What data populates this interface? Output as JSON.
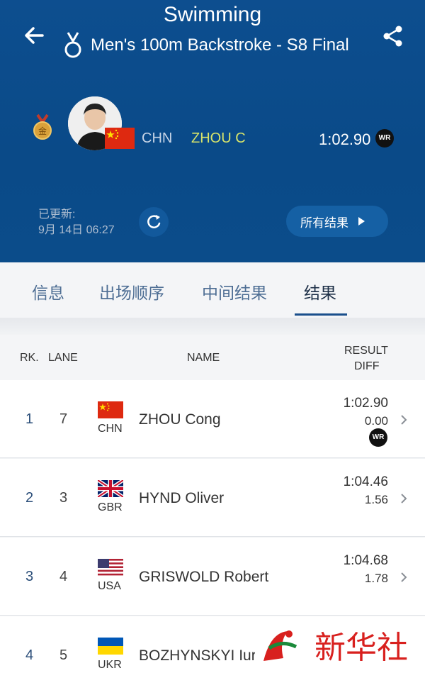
{
  "header": {
    "sport": "Swimming",
    "event": "Men's 100m Backstroke - S8 Final"
  },
  "winner": {
    "noc": "CHN",
    "name": "ZHOU C",
    "time": "1:02.90",
    "record": "WR",
    "medal_text": "金"
  },
  "update": {
    "label": "已更新:",
    "time": "9月 14日 06:27"
  },
  "all_results_label": "所有结果",
  "tabs": [
    {
      "label": "信息"
    },
    {
      "label": "出场顺序"
    },
    {
      "label": "中间结果"
    },
    {
      "label": "结果",
      "active": true
    }
  ],
  "table": {
    "headers": {
      "rank": "RK.",
      "lane": "LANE",
      "name": "NAME",
      "result": "RESULT",
      "diff": "DIFF"
    },
    "rows": [
      {
        "rank": "1",
        "lane": "7",
        "noc": "CHN",
        "name": "ZHOU Cong",
        "result": "1:02.90",
        "diff": "0.00",
        "record": "WR"
      },
      {
        "rank": "2",
        "lane": "3",
        "noc": "GBR",
        "name": "HYND Oliver",
        "result": "1:04.46",
        "diff": "1.56"
      },
      {
        "rank": "3",
        "lane": "4",
        "noc": "USA",
        "name": "GRISWOLD Robert",
        "result": "1:04.68",
        "diff": "1.78"
      },
      {
        "rank": "4",
        "lane": "5",
        "noc": "UKR",
        "name": "BOZHYNSKYI Iur",
        "result": "",
        "diff": ""
      }
    ]
  },
  "watermark": {
    "text": "新华社"
  },
  "colors": {
    "header_bg": "#0b4c8a",
    "winner_name": "#d7e46a",
    "tab_active": "#1d2f47",
    "tab_inactive": "#4e6e94",
    "gold": "#d9a13a"
  }
}
